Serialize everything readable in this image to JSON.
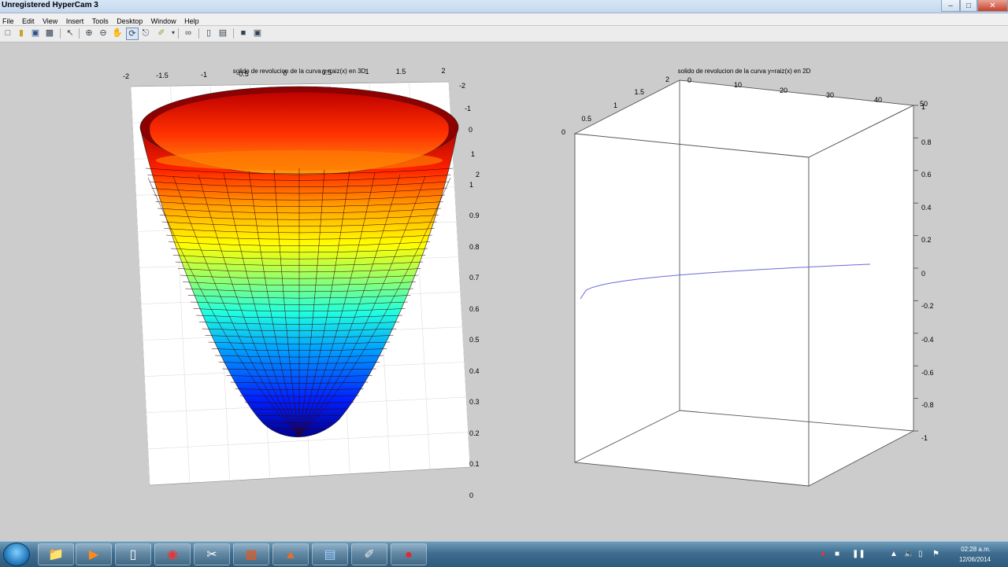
{
  "window": {
    "title": "Unregistered HyperCam 3",
    "controls": {
      "minimize": "–",
      "maximize": "□",
      "close": "✕"
    }
  },
  "menu": [
    "File",
    "Edit",
    "View",
    "Insert",
    "Tools",
    "Desktop",
    "Window",
    "Help"
  ],
  "toolbar_icons": [
    "new-figure-icon",
    "open-file-icon",
    "save-icon",
    "print-icon",
    "select-arrow-icon",
    "zoom-in-icon",
    "zoom-out-icon",
    "pan-hand-icon",
    "rotate-3d-icon",
    "data-cursor-icon",
    "brush-icon",
    "link-plot-icon",
    "colorbar-icon",
    "legend-icon",
    "hide-plot-tools-icon",
    "show-plot-tools-icon"
  ],
  "plot_left": {
    "title": "solido de revolucion de la curva y=raiz(x) en 3D",
    "x_ticks": [
      "-2",
      "-1.5",
      "-1",
      "-0.5",
      "0",
      "0.5",
      "1",
      "1.5",
      "2"
    ],
    "y_ticks": [
      "-2",
      "-1",
      "0",
      "1",
      "2"
    ],
    "z_ticks": [
      "1",
      "0.9",
      "0.8",
      "0.7",
      "0.6",
      "0.5",
      "0.4",
      "0.3",
      "0.2",
      "0.1",
      "0"
    ],
    "colormap": [
      "#00008f",
      "#0020ff",
      "#00a0ff",
      "#20ffdf",
      "#a0ff60",
      "#ffff00",
      "#ffa000",
      "#ff2000",
      "#a00000"
    ]
  },
  "plot_right": {
    "title": "solido de revolucion de la curva y=raiz(x) en 2D",
    "x_ticks": [
      "0",
      "10",
      "20",
      "30",
      "40",
      "50"
    ],
    "y_ticks": [
      "0",
      "0.5",
      "1",
      "1.5",
      "2"
    ],
    "z_ticks": [
      "1",
      "0.8",
      "0.6",
      "0.4",
      "0.2",
      "0",
      "-0.2",
      "-0.4",
      "-0.6",
      "-0.8",
      "-1"
    ],
    "line_color": "#6b6bd8"
  },
  "taskbar": {
    "apps": [
      "folder-icon",
      "media-player-icon",
      "document-icon",
      "chrome-icon",
      "snipping-tool-icon",
      "powerpoint-icon",
      "matlab-icon",
      "explorer-icon",
      "paint-icon",
      "hypercam-record-icon"
    ],
    "clock_time": "02:28 a.m.",
    "clock_date": "12/06/2014"
  }
}
